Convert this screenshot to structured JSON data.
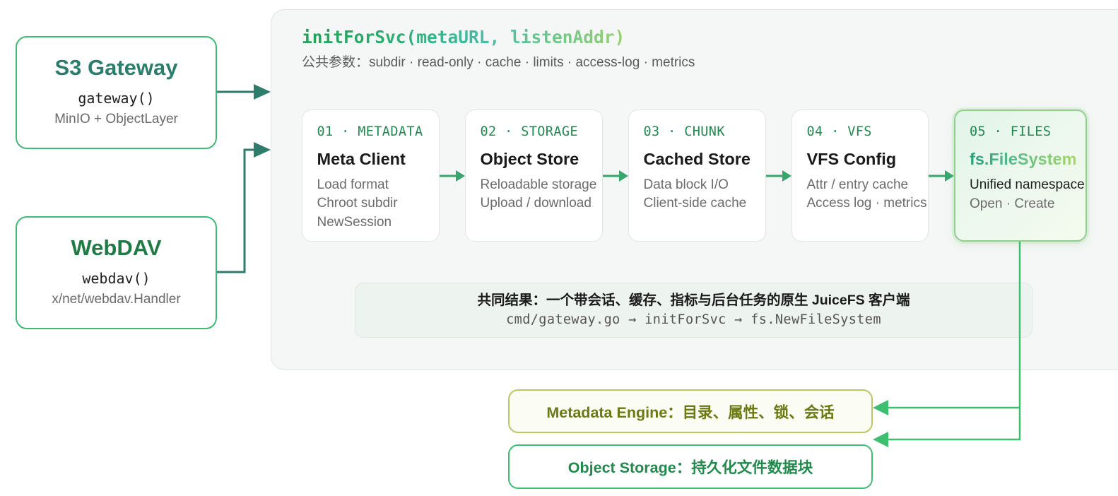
{
  "clients": [
    {
      "title": "S3 Gateway",
      "func": "gateway()",
      "desc": "MinIO + ObjectLayer"
    },
    {
      "title": "WebDAV",
      "func": "webdav()",
      "desc": "x/net/webdav.Handler"
    }
  ],
  "panel": {
    "title": "initForSvc(metaURL, listenAddr)",
    "params": "公共参数：subdir · read-only · cache · limits · access-log · metrics",
    "stages": [
      {
        "tag": "01 · METADATA",
        "name": "Meta Client",
        "lines": [
          "Load format",
          "Chroot subdir",
          "NewSession"
        ]
      },
      {
        "tag": "02 · STORAGE",
        "name": "Object Store",
        "lines": [
          "Reloadable storage",
          "Upload / download"
        ]
      },
      {
        "tag": "03 · CHUNK",
        "name": "Cached Store",
        "lines": [
          "Data block I/O",
          "Client-side cache"
        ]
      },
      {
        "tag": "04 · VFS",
        "name": "VFS Config",
        "lines": [
          "Attr / entry cache",
          "Access log · metrics"
        ]
      },
      {
        "tag": "05 · FILES",
        "name": "fs.FileSystem",
        "lines": [
          "Unified namespace",
          "Open · Create"
        ]
      }
    ],
    "result": {
      "title": "共同结果：一个带会话、缓存、指标与后台任务的原生 JuiceFS 客户端",
      "path": "cmd/gateway.go → initForSvc → fs.NewFileSystem"
    }
  },
  "backends": [
    {
      "label": "Metadata Engine：目录、属性、锁、会话"
    },
    {
      "label": "Object Storage：持久化文件数据块"
    }
  ],
  "colors": {
    "client_border": "#3dbb72",
    "s3_title": "#2b7d6d",
    "webdav_title": "#207a43",
    "client_arrow": "#2e7c6c",
    "stage_tag": "#1f8a4f",
    "stage_arrow": "#37a66c",
    "highlight_border": "#8fd08a",
    "output_line": "#3dbf6f",
    "metadata_border": "#b9c862",
    "metadata_text": "#6b7a12",
    "storage_border": "#3dbf6f",
    "storage_text": "#1f8a4b"
  }
}
